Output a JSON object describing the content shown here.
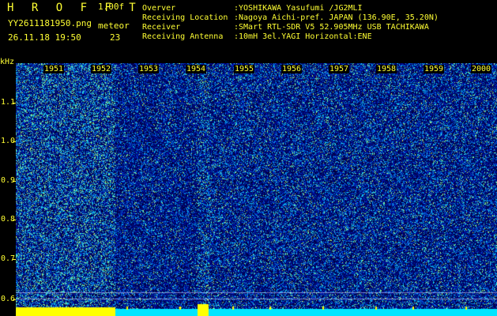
{
  "header": {
    "title": "H R O F F T",
    "version": "1.00f",
    "filename": "YY2611181950.png",
    "datetime": "26.11.18 19:50",
    "meteor_label": "meteor",
    "meteor_count": "23"
  },
  "info": [
    {
      "key": "Overver",
      "value": ":YOSHIKAWA Yasufumi /JG2MLI"
    },
    {
      "key": "Receiving Location",
      "value": ":Nagoya Aichi-pref. JAPAN (136.90E, 35.20N)"
    },
    {
      "key": "Receiver",
      "value": ":SMart RTL-SDR V5 52.905MHz USB TACHIKAWA"
    },
    {
      "key": "Receiving Antenna",
      "value": ":10mH 3el.YAGI Horizontal:ENE"
    }
  ],
  "axis": {
    "unit": "kHz",
    "y_ticks": [
      "1.1",
      "1.0",
      "0.9",
      "0.8",
      "0.7",
      "0.6"
    ]
  },
  "minute_labels": [
    "1951",
    "1952",
    "1953",
    "1954",
    "1955",
    "1956",
    "1957",
    "1958",
    "1959",
    "2000"
  ],
  "colors": {
    "text": "#ffff33",
    "background": "#000000",
    "level_low": "#0000a0",
    "level_high": "#00ffff",
    "meter": "#ffff00"
  }
}
